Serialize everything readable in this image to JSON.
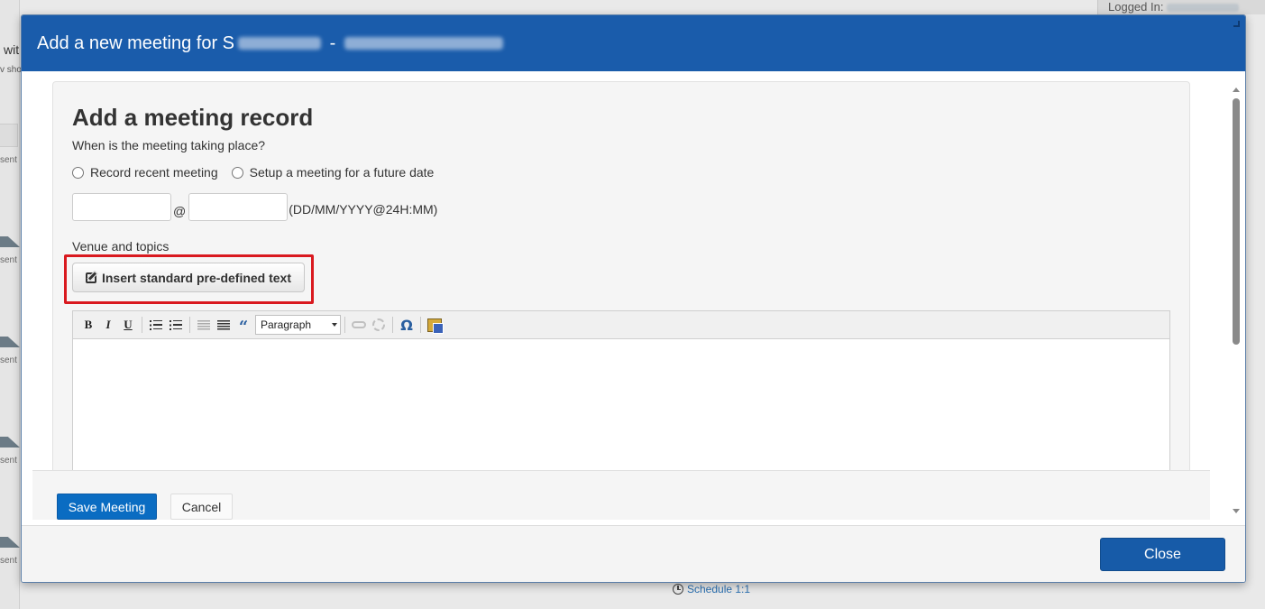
{
  "background": {
    "logged_in_label": "Logged In:",
    "partial_heading": "wit",
    "partial_sub": "v sho",
    "sent_labels": [
      "sent",
      "sent",
      "sent",
      "sent",
      "sent"
    ],
    "schedule_link": "Schedule 1:1"
  },
  "modal": {
    "title_prefix": "Add a new meeting for S",
    "title_separator": " - ",
    "panel_title": "Add a meeting record",
    "question": "When is the meeting taking place?",
    "radio_options": [
      "Record recent meeting",
      "Setup a meeting for a future date"
    ],
    "date_input": {
      "value": "",
      "placeholder": ""
    },
    "time_input": {
      "value": "",
      "placeholder": ""
    },
    "at_symbol": "@",
    "format_hint": "(DD/MM/YYYY@24H:MM)",
    "venue_label": "Venue and topics",
    "insert_button": "Insert standard pre-defined text",
    "editor": {
      "bold": "B",
      "italic": "I",
      "underline": "U",
      "quote": "“",
      "format_select": "Paragraph",
      "omega": "Ω"
    },
    "save_button": "Save Meeting",
    "cancel_button": "Cancel",
    "close_button": "Close"
  },
  "colors": {
    "header_blue": "#1a5cab",
    "primary_button": "#0a6cc2",
    "close_button": "#175ba8",
    "highlight_red": "#d9191f"
  }
}
